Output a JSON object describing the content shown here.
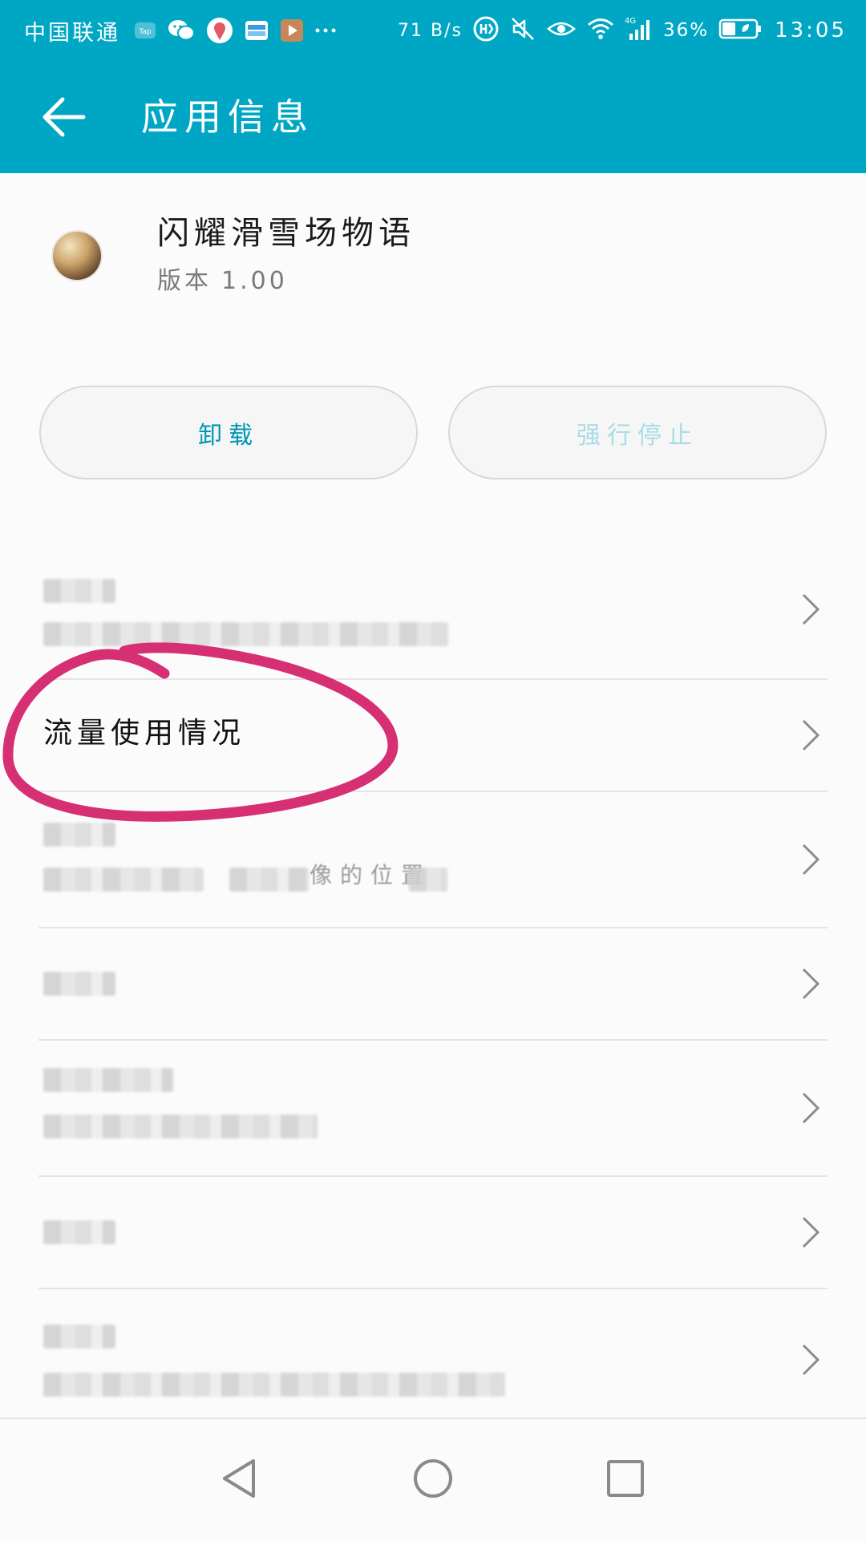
{
  "status_bar": {
    "carrier": "中国联通",
    "net_speed": "71 B/s",
    "network_type": "4G",
    "battery_percent": "36%",
    "time": "13:05",
    "icons": [
      "taptap-icon",
      "wechat-icon",
      "location-app-icon",
      "wallet-icon",
      "video-app-icon",
      "more-notifications-icon",
      "hd-icon",
      "mute-icon",
      "eye-comfort-icon",
      "wifi-icon",
      "signal-icon",
      "battery-icon"
    ]
  },
  "app_bar": {
    "title": "应用信息"
  },
  "app_header": {
    "name": "闪耀滑雪场物语",
    "version_label": "版本",
    "version_value": "1.00"
  },
  "actions": {
    "uninstall_label": "卸载",
    "force_stop_label": "强行停止"
  },
  "list": {
    "data_usage_title": "流量使用情况",
    "row3_subtitle_fragment": "像的位置"
  },
  "colors": {
    "header": "#00a7c4",
    "accent_text": "#0097b5",
    "disabled_text": "#a8dce6",
    "annotation": "#d62f74"
  }
}
